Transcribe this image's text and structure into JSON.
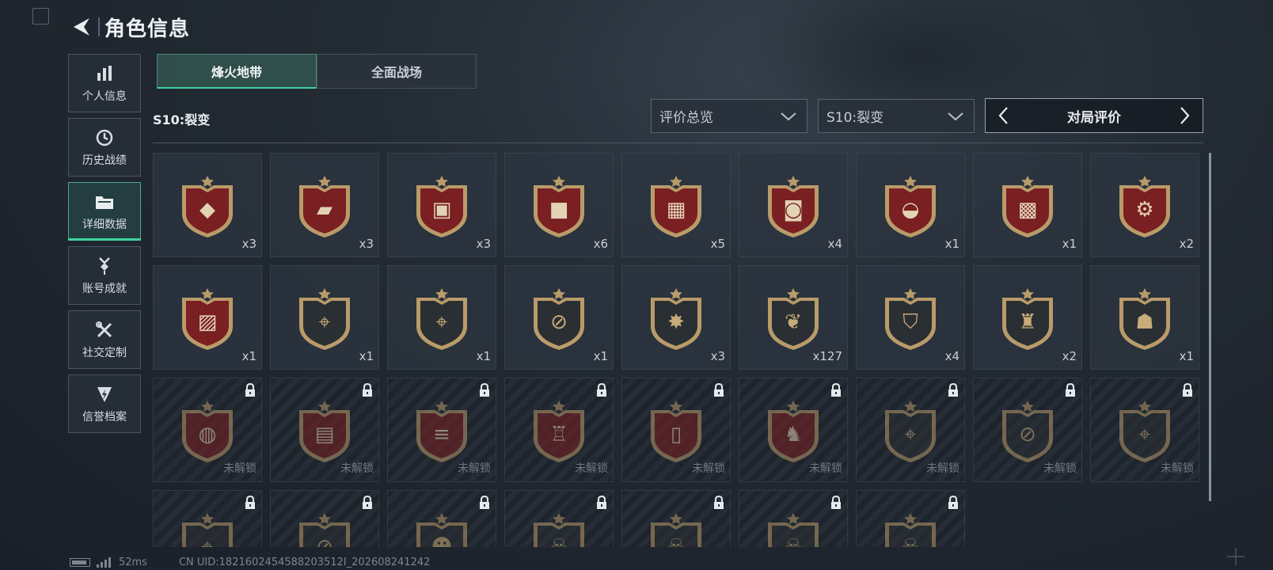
{
  "header": {
    "title": "角色信息"
  },
  "sidebar": {
    "items": [
      {
        "label": "个人信息",
        "icon": "bar-chart-icon",
        "active": false
      },
      {
        "label": "历史战绩",
        "icon": "clock-icon",
        "active": false
      },
      {
        "label": "详细数据",
        "icon": "folder-icon",
        "active": true
      },
      {
        "label": "账号成就",
        "icon": "medal-icon",
        "active": false
      },
      {
        "label": "社交定制",
        "icon": "tools-icon",
        "active": false
      },
      {
        "label": "信誉档案",
        "icon": "credit-icon",
        "active": false
      }
    ]
  },
  "tabs": [
    {
      "label": "烽火地带",
      "active": true
    },
    {
      "label": "全面战场",
      "active": false
    }
  ],
  "season_label": "S10:裂变",
  "filters": {
    "dropdown_1": "评价总览",
    "dropdown_2": "S10:裂变",
    "pager_label": "对局评价"
  },
  "colors": {
    "accent": "#3fd3a0",
    "badge_red": "#7a1f22",
    "badge_gold": "#b99b6a",
    "badge_dark": "#2a2f33"
  },
  "badges": [
    {
      "icon": "diamond-icon",
      "style": "red",
      "count": "x3"
    },
    {
      "icon": "tank-icon",
      "style": "red",
      "count": "x3"
    },
    {
      "icon": "computer-icon",
      "style": "red",
      "count": "x3"
    },
    {
      "icon": "metal-plate-icon",
      "style": "red",
      "count": "x6"
    },
    {
      "icon": "circuit-board-icon",
      "style": "red",
      "count": "x5"
    },
    {
      "icon": "robot-vacuum-icon",
      "style": "red",
      "count": "x4"
    },
    {
      "icon": "gold-helmet-icon",
      "style": "red",
      "count": "x1"
    },
    {
      "icon": "chess-board-icon",
      "style": "red",
      "count": "x1"
    },
    {
      "icon": "device-icon",
      "style": "red",
      "count": "x2"
    },
    {
      "icon": "painting-icon",
      "style": "red",
      "count": "x1"
    },
    {
      "icon": "rifle-target-icon",
      "style": "dark",
      "count": "x1"
    },
    {
      "icon": "rifle-target-icon",
      "style": "dark",
      "count": "x1"
    },
    {
      "icon": "knife-target-icon",
      "style": "dark",
      "count": "x1"
    },
    {
      "icon": "explosion-icon",
      "style": "dark",
      "count": "x3"
    },
    {
      "icon": "laurel-emblem-icon",
      "style": "dark",
      "count": "x127"
    },
    {
      "icon": "laurel-shield-icon",
      "style": "dark",
      "count": "x4"
    },
    {
      "icon": "hooded-target-icon",
      "style": "dark",
      "count": "x2"
    },
    {
      "icon": "mask-target-icon",
      "style": "dark",
      "count": "x1"
    },
    {
      "icon": "globe-icon",
      "style": "red",
      "locked": true,
      "status": "未解锁"
    },
    {
      "icon": "tablet-icon",
      "style": "red",
      "locked": true,
      "status": "未解锁"
    },
    {
      "icon": "bars-icon",
      "style": "red",
      "locked": true,
      "status": "未解锁"
    },
    {
      "icon": "lantern-icon",
      "style": "red",
      "locked": true,
      "status": "未解锁"
    },
    {
      "icon": "capsule-icon",
      "style": "red",
      "locked": true,
      "status": "未解锁"
    },
    {
      "icon": "sculpture-icon",
      "style": "red",
      "locked": true,
      "status": "未解锁"
    },
    {
      "icon": "rifle-target-icon",
      "style": "dark",
      "locked": true,
      "status": "未解锁"
    },
    {
      "icon": "knife-target-icon",
      "style": "dark",
      "locked": true,
      "status": "未解锁"
    },
    {
      "icon": "rifle-target-icon",
      "style": "dark",
      "locked": true,
      "status": "未解锁"
    },
    {
      "icon": "rifle-target-icon",
      "style": "dark",
      "locked": true
    },
    {
      "icon": "knife-target-icon",
      "style": "dark",
      "locked": true
    },
    {
      "icon": "soldier-icon",
      "style": "dark",
      "locked": true
    },
    {
      "icon": "skull-target-icon",
      "style": "dark",
      "locked": true
    },
    {
      "icon": "skull-target-icon",
      "style": "dark",
      "locked": true
    },
    {
      "icon": "skull-target-icon",
      "style": "dark",
      "locked": true
    },
    {
      "icon": "skull-target-icon",
      "style": "dark",
      "locked": true
    }
  ],
  "footer": {
    "ping": "52ms",
    "uid": "CN UID:1821602454588203512I_202608241242"
  }
}
